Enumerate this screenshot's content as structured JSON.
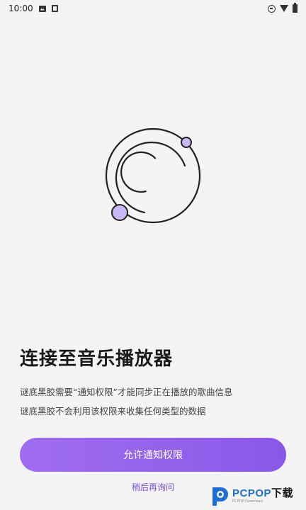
{
  "status_bar": {
    "time": "10:00",
    "left_icons": [
      "image-icon",
      "download-box-icon"
    ],
    "right_icons": [
      "do-not-disturb-icon",
      "wifi-icon",
      "battery-icon"
    ]
  },
  "logo": {
    "icon": "orbit-logo-icon",
    "accent": "#c8b8f5",
    "stroke": "#222222"
  },
  "title": "连接至音乐播放器",
  "descriptions": [
    "谜底黑胶需要“通知权限”才能同步正在播放的歌曲信息",
    "谜底黑胶不会利用该权限来收集任何类型的数据"
  ],
  "allow_button": {
    "label": "允许通知权限",
    "color": "#9461ec"
  },
  "later_link": {
    "label": "稍后再询问"
  },
  "watermark": {
    "brand": "PCPOP",
    "suffix": "下载",
    "sub": "PCPOP Download"
  }
}
